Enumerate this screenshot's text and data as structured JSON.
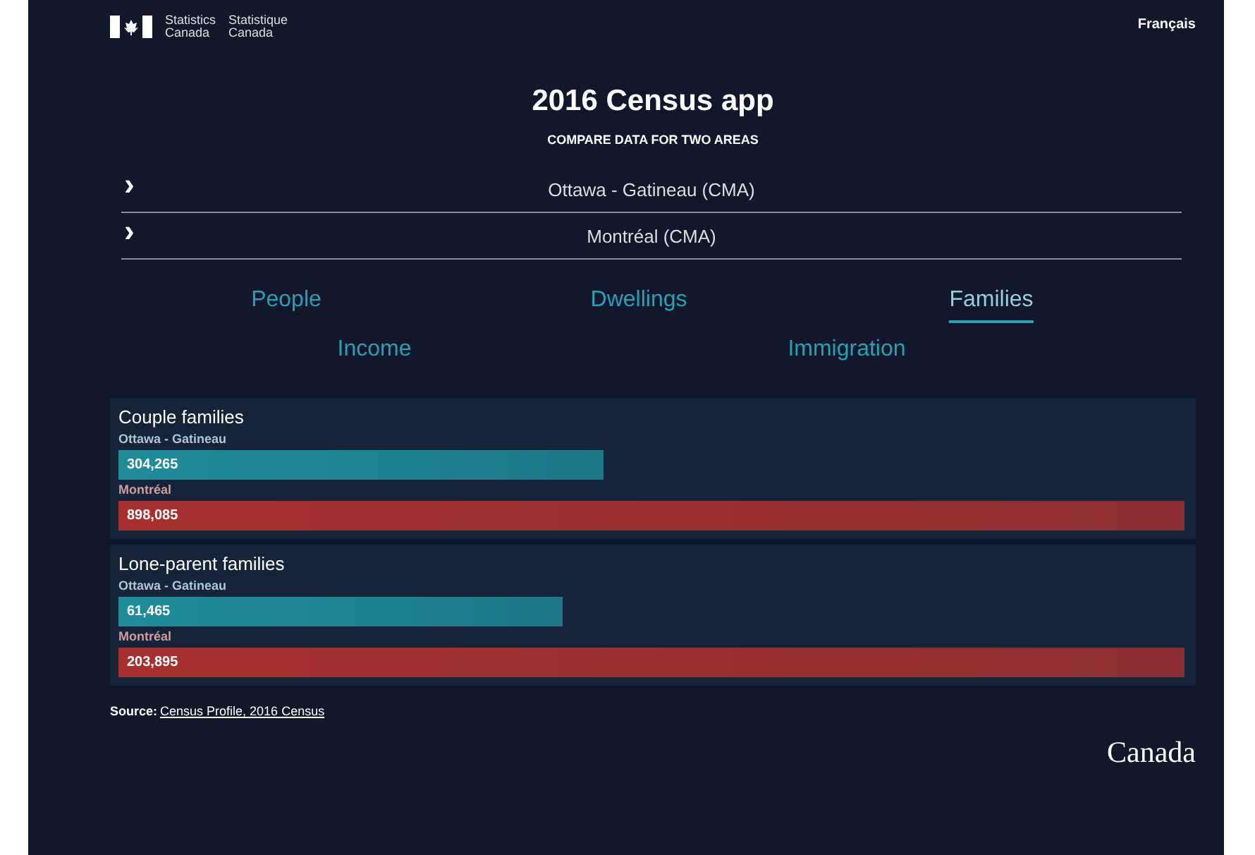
{
  "header": {
    "agency_en": [
      "Statistics",
      "Canada"
    ],
    "agency_fr": [
      "Statistique",
      "Canada"
    ],
    "language_link": "Français"
  },
  "title": "2016 Census app",
  "subtitle": "COMPARE DATA FOR TWO AREAS",
  "areas": [
    {
      "icon": "›",
      "name": "Ottawa - Gatineau (CMA)"
    },
    {
      "icon": "›",
      "name": "Montréal (CMA)"
    }
  ],
  "tabs": [
    {
      "label": "People",
      "selected": false
    },
    {
      "label": "Dwellings",
      "selected": false
    },
    {
      "label": "Families",
      "selected": true
    },
    {
      "label": "Income",
      "selected": false
    },
    {
      "label": "Immigration",
      "selected": false
    }
  ],
  "panels": [
    {
      "title": "Couple families",
      "bars": [
        {
          "area": "Ottawa - Gatineau",
          "value": "304,265",
          "level": 0.455,
          "color": "#1f8c9a"
        },
        {
          "area": "Montréal",
          "value": "898,085",
          "level": 1,
          "color": "#a8302f"
        }
      ]
    },
    {
      "title": "Lone-parent families",
      "bars": [
        {
          "area": "Ottawa - Gatineau",
          "value": "61,465",
          "level": 0.417,
          "color": "#1f8c9a"
        },
        {
          "area": "Montréal",
          "value": "203,895",
          "level": 1,
          "color": "#a8302f"
        }
      ]
    }
  ],
  "source": {
    "label": "Source:",
    "link": "Census Profile, 2016 Census"
  },
  "wordmark": "Canada"
}
